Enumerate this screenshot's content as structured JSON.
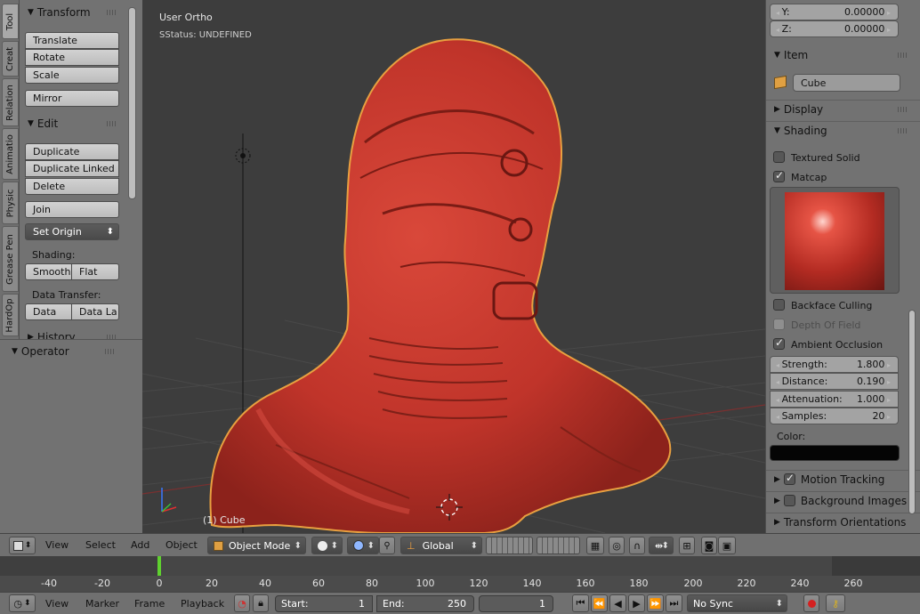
{
  "tool_tabs": [
    "Tool",
    "Creat",
    "Relation",
    "Animatio",
    "Physic",
    "Grease Pen",
    "HardOp"
  ],
  "toolshelf": {
    "transform_header": "Transform",
    "translate": "Translate",
    "rotate": "Rotate",
    "scale": "Scale",
    "mirror": "Mirror",
    "edit_header": "Edit",
    "duplicate": "Duplicate",
    "duplicate_linked": "Duplicate Linked",
    "delete": "Delete",
    "join": "Join",
    "set_origin": "Set Origin",
    "shading_label": "Shading:",
    "smooth": "Smooth",
    "flat": "Flat",
    "data_transfer_label": "Data Transfer:",
    "data": "Data",
    "data_la": "Data La",
    "history_header": "History"
  },
  "operator": {
    "header": "Operator"
  },
  "viewport": {
    "view_name": "User Ortho",
    "status": "SStatus: UNDEFINED",
    "object_label": "(1) Cube"
  },
  "npanel": {
    "y_label": "Y:",
    "y_value": "0.00000",
    "z_label": "Z:",
    "z_value": "0.00000",
    "item_header": "Item",
    "item_name": "Cube",
    "display_header": "Display",
    "shading_header": "Shading",
    "textured_solid": "Textured Solid",
    "matcap": "Matcap",
    "backface_culling": "Backface Culling",
    "depth_of_field": "Depth Of Field",
    "ambient_occlusion": "Ambient Occlusion",
    "strength_label": "Strength:",
    "strength_value": "1.800",
    "distance_label": "Distance:",
    "distance_value": "0.190",
    "attenuation_label": "Attenuation:",
    "attenuation_value": "1.000",
    "samples_label": "Samples:",
    "samples_value": "20",
    "color_label": "Color:",
    "motion_tracking": "Motion Tracking",
    "background_images": "Background Images",
    "transform_orientations": "Transform Orientations"
  },
  "header": {
    "view": "View",
    "select": "Select",
    "add": "Add",
    "object": "Object",
    "mode": "Object Mode",
    "orientation": "Global"
  },
  "timeline": {
    "ticks": [
      "-40",
      "-20",
      "0",
      "20",
      "40",
      "60",
      "80",
      "100",
      "120",
      "140",
      "160",
      "180",
      "200",
      "220",
      "240",
      "260"
    ]
  },
  "footer": {
    "view": "View",
    "marker": "Marker",
    "frame": "Frame",
    "playback": "Playback",
    "start_label": "Start:",
    "start_value": "1",
    "end_label": "End:",
    "end_value": "250",
    "current_frame": "1",
    "sync": "No Sync"
  },
  "colors": {
    "model_red": "#c8372c",
    "selection_outline": "#e8a040",
    "viewport_bg": "#3d3d3d",
    "panel_bg": "#727272",
    "current_frame_marker": "#5fd12f"
  }
}
